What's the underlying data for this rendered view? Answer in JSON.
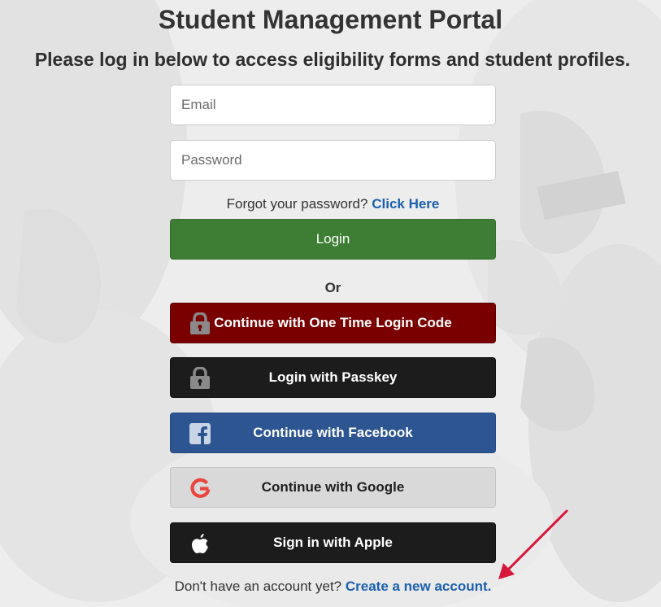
{
  "page": {
    "title": "Student Management Portal",
    "subtitle": "Please log in below to access eligibility forms and student profiles."
  },
  "form": {
    "email_placeholder": "Email",
    "password_placeholder": "Password",
    "forgot_text": "Forgot your password?",
    "forgot_link": "Click Here",
    "login_label": "Login",
    "or_label": "Or"
  },
  "alt_logins": {
    "otp_label": "Continue with One Time Login Code",
    "passkey_label": "Login with Passkey",
    "facebook_label": "Continue with Facebook",
    "google_label": "Continue with Google",
    "apple_label": "Sign in with Apple"
  },
  "footer": {
    "signup_text": "Don't have an account yet?",
    "signup_link": "Create a new account."
  },
  "icons": {
    "otp": "lock-icon",
    "passkey": "lock-icon",
    "facebook": "facebook-icon",
    "google": "google-icon",
    "apple": "apple-icon",
    "annotation": "red-arrow-icon"
  },
  "colors": {
    "login": "#3d7d34",
    "otp": "#7a0000",
    "passkey": "#1c1c1c",
    "facebook": "#2d5592",
    "google": "#d9d9d9",
    "apple": "#1c1c1c",
    "link": "#1a5fb0",
    "arrow": "#d6173a"
  }
}
